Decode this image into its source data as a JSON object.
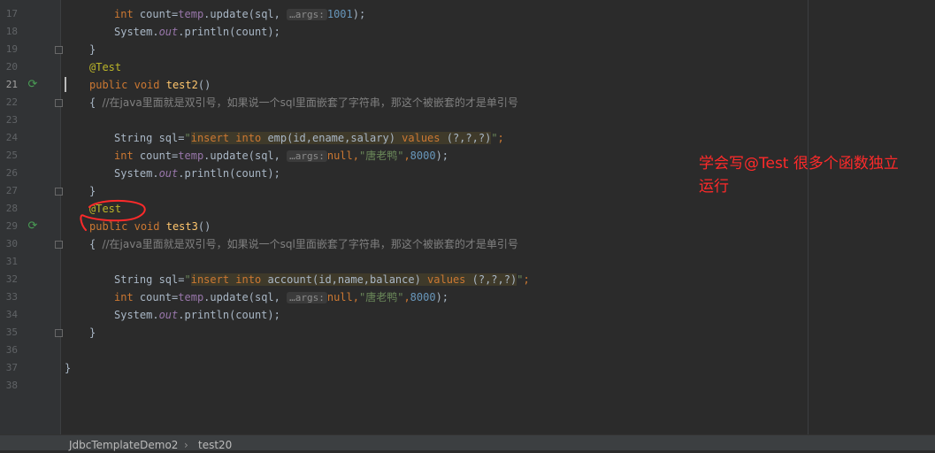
{
  "lines": [
    {
      "n": "17"
    },
    {
      "n": "18"
    },
    {
      "n": "19"
    },
    {
      "n": "20"
    },
    {
      "n": "21"
    },
    {
      "n": "22"
    },
    {
      "n": "23"
    },
    {
      "n": "24"
    },
    {
      "n": "25"
    },
    {
      "n": "26"
    },
    {
      "n": "27"
    },
    {
      "n": "28"
    },
    {
      "n": "29"
    },
    {
      "n": "30"
    },
    {
      "n": "31"
    },
    {
      "n": "32"
    },
    {
      "n": "33"
    },
    {
      "n": "34"
    },
    {
      "n": "35"
    },
    {
      "n": "36"
    },
    {
      "n": "37"
    },
    {
      "n": "38"
    }
  ],
  "code": {
    "l17": {
      "a": "int",
      "b": " count=",
      "c": "temp",
      "d": ".update(sql, ",
      "hint": "…args:",
      "num": "1001",
      "e": ");"
    },
    "l18": {
      "a": "System.",
      "b": "out",
      "c": ".println(count);"
    },
    "l19": "}",
    "l20": "@Test",
    "l21": {
      "a": "public",
      "b": " ",
      "c": "void",
      "d": " ",
      "fn": "test2",
      "e": "()"
    },
    "l22": {
      "a": "{ ",
      "comment": "//在java里面就是双引号，如果说一个sql里面嵌套了字符串，那这个被嵌套的才是单引号"
    },
    "l24": {
      "a": "String sql=",
      "q1": "\"",
      "ins": "insert",
      "into": " into ",
      "tbl": "emp(id,ename,salary)",
      "values": " values ",
      "params": "(?,?,?)",
      "q2": "\"",
      "end": ";"
    },
    "l25": {
      "a": "int",
      "b": " count=",
      "c": "temp",
      "d": ".update(sql, ",
      "hint": "…args:",
      "kwnull": "null",
      "comma": ",",
      "str": "\"唐老鸭\"",
      "comma2": ",",
      "num": "8000",
      "e": ");"
    },
    "l26": {
      "a": "System.",
      "b": "out",
      "c": ".println(count);"
    },
    "l27": "}",
    "l28": "@Test",
    "l29": {
      "a": "public",
      "b": " ",
      "c": "void",
      "d": " ",
      "fn": "test3",
      "e": "()"
    },
    "l30": {
      "a": "{ ",
      "comment": "//在java里面就是双引号，如果说一个sql里面嵌套了字符串，那这个被嵌套的才是单引号"
    },
    "l32": {
      "a": "String sql=",
      "q1": "\"",
      "ins": "insert",
      "into": " into ",
      "tbl": "account(id,name,balance)",
      "values": " values ",
      "params": "(?,?,?)",
      "q2": "\"",
      "end": ";"
    },
    "l33": {
      "a": "int",
      "b": " count=",
      "c": "temp",
      "d": ".update(sql, ",
      "hint": "…args:",
      "kwnull": "null",
      "comma": ",",
      "str": "\"唐老鸭\"",
      "comma2": ",",
      "num": "8000",
      "e": ");"
    },
    "l34": {
      "a": "System.",
      "b": "out",
      "c": ".println(count);"
    },
    "l35": "}",
    "l37": "}"
  },
  "note": {
    "line1": "学会写@Test  很多个函数独立",
    "line2": "运行"
  },
  "breadcrumb": {
    "class": "JdbcTemplateDemo2",
    "method": "test20"
  },
  "colors": {
    "annotation_red": "#ff2a2a",
    "run_icon": "#499c54"
  }
}
